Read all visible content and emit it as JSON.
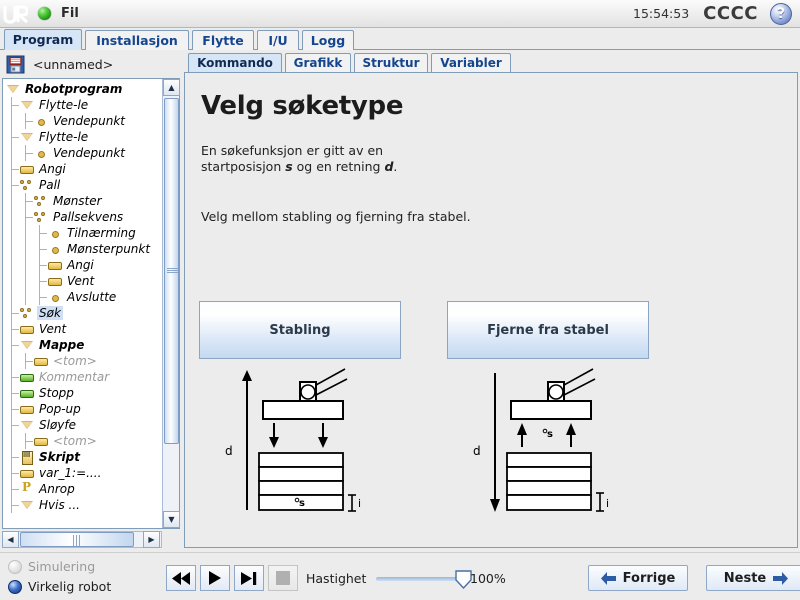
{
  "titlebar": {
    "logo": "ur-logo",
    "menu_icon": "green-ball-icon",
    "menu_label": "Fil",
    "clock": "15:54:53",
    "robot_name": "CCCC",
    "help_label": "?"
  },
  "main_tabs": [
    {
      "label": "Program",
      "active": true
    },
    {
      "label": "Installasjon",
      "active": false
    },
    {
      "label": "Flytte",
      "active": false
    },
    {
      "label": "I/U",
      "active": false
    },
    {
      "label": "Logg",
      "active": false
    }
  ],
  "program_panel": {
    "file_icon": "floppy-disk-icon",
    "file_name": "<unnamed>",
    "tree": [
      {
        "label": "Robotprogram",
        "icon": "triangle-icon",
        "depth": 0,
        "bold": true,
        "selected": false,
        "dim": false
      },
      {
        "label": "Flytte-le",
        "icon": "triangle-icon",
        "depth": 1,
        "bold": false,
        "selected": false,
        "dim": false
      },
      {
        "label": "Vendepunkt",
        "icon": "dot-icon",
        "depth": 2,
        "bold": false,
        "selected": false,
        "dim": false
      },
      {
        "label": "Flytte-le",
        "icon": "triangle-icon",
        "depth": 1,
        "bold": false,
        "selected": false,
        "dim": false
      },
      {
        "label": "Vendepunkt",
        "icon": "dot-icon",
        "depth": 2,
        "bold": false,
        "selected": false,
        "dim": false
      },
      {
        "label": "Angi",
        "icon": "yellow-rect-icon",
        "depth": 1,
        "bold": false,
        "selected": false,
        "dim": false
      },
      {
        "label": "Pall",
        "icon": "pallet-icon",
        "depth": 1,
        "bold": false,
        "selected": false,
        "dim": false
      },
      {
        "label": "Mønster",
        "icon": "pallet-icon",
        "depth": 2,
        "bold": false,
        "selected": false,
        "dim": false
      },
      {
        "label": "Pallsekvens",
        "icon": "pallet-icon",
        "depth": 2,
        "bold": false,
        "selected": false,
        "dim": false
      },
      {
        "label": "Tilnærming",
        "icon": "dot-icon",
        "depth": 3,
        "bold": false,
        "selected": false,
        "dim": false
      },
      {
        "label": "Mønsterpunkt",
        "icon": "dot-icon",
        "depth": 3,
        "bold": false,
        "selected": false,
        "dim": false
      },
      {
        "label": "Angi",
        "icon": "yellow-rect-icon",
        "depth": 3,
        "bold": false,
        "selected": false,
        "dim": false
      },
      {
        "label": "Vent",
        "icon": "yellow-rect-icon",
        "depth": 3,
        "bold": false,
        "selected": false,
        "dim": false
      },
      {
        "label": "Avslutte",
        "icon": "dot-icon",
        "depth": 3,
        "bold": false,
        "selected": false,
        "dim": false
      },
      {
        "label": "Søk",
        "icon": "pallet-icon",
        "depth": 1,
        "bold": false,
        "selected": true,
        "dim": false
      },
      {
        "label": "Vent",
        "icon": "yellow-rect-icon",
        "depth": 1,
        "bold": false,
        "selected": false,
        "dim": false
      },
      {
        "label": "Mappe",
        "icon": "triangle-icon",
        "depth": 1,
        "bold": true,
        "selected": false,
        "dim": false
      },
      {
        "label": "<tom>",
        "icon": "yellow-rect-icon",
        "depth": 2,
        "bold": false,
        "selected": false,
        "dim": true
      },
      {
        "label": "Kommentar",
        "icon": "green-rect-icon",
        "depth": 1,
        "bold": false,
        "selected": false,
        "dim": true
      },
      {
        "label": "Stopp",
        "icon": "green-rect-icon",
        "depth": 1,
        "bold": false,
        "selected": false,
        "dim": false
      },
      {
        "label": "Pop-up",
        "icon": "yellow-rect-icon",
        "depth": 1,
        "bold": false,
        "selected": false,
        "dim": false
      },
      {
        "label": "Sløyfe",
        "icon": "triangle-icon",
        "depth": 1,
        "bold": false,
        "selected": false,
        "dim": false
      },
      {
        "label": "<tom>",
        "icon": "yellow-rect-icon",
        "depth": 2,
        "bold": false,
        "selected": false,
        "dim": true
      },
      {
        "label": "Skript",
        "icon": "script-icon",
        "depth": 1,
        "bold": true,
        "selected": false,
        "dim": false
      },
      {
        "label": "var_1:=....",
        "icon": "yellow-rect-icon",
        "depth": 1,
        "bold": false,
        "selected": false,
        "dim": false
      },
      {
        "label": "Anrop",
        "icon": "call-icon",
        "depth": 1,
        "bold": false,
        "selected": false,
        "dim": false
      },
      {
        "label": "Hvis ...",
        "icon": "triangle-icon",
        "depth": 1,
        "bold": false,
        "selected": false,
        "dim": false
      }
    ]
  },
  "sub_tabs": [
    {
      "label": "Kommando",
      "active": true
    },
    {
      "label": "Grafikk",
      "active": false
    },
    {
      "label": "Struktur",
      "active": false
    },
    {
      "label": "Variabler",
      "active": false
    }
  ],
  "content": {
    "heading": "Velg søketype",
    "paragraph_line1": "En søkefunksjon er gitt av en",
    "paragraph_line2_a": "startposisjon ",
    "paragraph_line2_s": "s",
    "paragraph_line2_b": " og en retning ",
    "paragraph_line2_d": "d",
    "paragraph_line2_c": ".",
    "paragraph2": "Velg mellom stabling og fjerning fra stabel.",
    "choice_a_label": "Stabling",
    "choice_b_label": "Fjerne fra stabel",
    "diagram_labels": {
      "distance": "d",
      "start": "s",
      "item": "i"
    }
  },
  "bottom_bar": {
    "simulation_label": "Simulering",
    "real_robot_label": "Virkelig robot",
    "rewind_icon": "skip-back-icon",
    "play_icon": "play-icon",
    "step_icon": "skip-forward-icon",
    "stop_icon": "stop-icon",
    "speed_label": "Hastighet",
    "speed_value": "100%",
    "prev_label": "Forrige",
    "next_label": "Neste"
  },
  "colors": {
    "accent_blue": "#15458f",
    "tab_active_bg": "#d6e6f7",
    "panel_bg": "#ececec",
    "border_blue": "#7f9db9",
    "selection_bg": "#cfe0f5"
  }
}
